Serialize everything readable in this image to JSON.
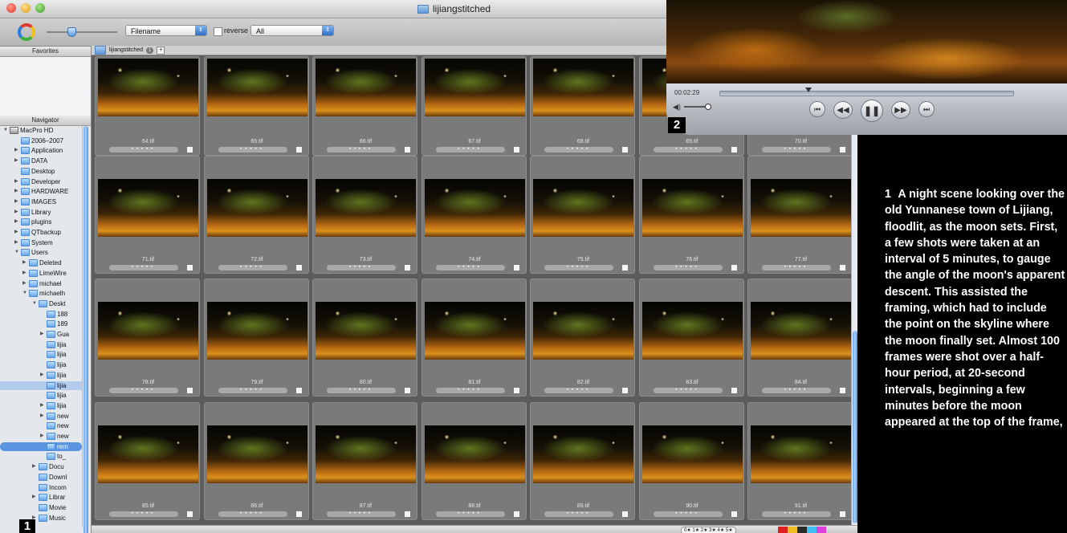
{
  "window": {
    "title": "lijiangstitched"
  },
  "toolbar": {
    "sort_value": "Filename",
    "reverse_label": "reverse",
    "filter_value": "All"
  },
  "sidebar": {
    "favorites_label": "Favorites",
    "navigator_label": "Navigator",
    "tree": [
      {
        "label": "MacPro HD",
        "depth": 0,
        "expanded": true
      },
      {
        "label": "2006–2007",
        "depth": 1
      },
      {
        "label": "Application",
        "depth": 1,
        "collapsed": true
      },
      {
        "label": "DATA",
        "depth": 1,
        "collapsed": true
      },
      {
        "label": "Desktop",
        "depth": 1
      },
      {
        "label": "Developer",
        "depth": 1,
        "collapsed": true
      },
      {
        "label": "HARDWARE",
        "depth": 1,
        "collapsed": true
      },
      {
        "label": "IMAGES",
        "depth": 1,
        "collapsed": true
      },
      {
        "label": "Library",
        "depth": 1,
        "collapsed": true
      },
      {
        "label": "plugins",
        "depth": 1,
        "collapsed": true
      },
      {
        "label": "QTbackup",
        "depth": 1,
        "collapsed": true
      },
      {
        "label": "System",
        "depth": 1,
        "collapsed": true
      },
      {
        "label": "Users",
        "depth": 1,
        "expanded": true
      },
      {
        "label": "Deleted",
        "depth": 2,
        "collapsed": true
      },
      {
        "label": "LimeWire",
        "depth": 2,
        "collapsed": true
      },
      {
        "label": "michael",
        "depth": 2,
        "collapsed": true
      },
      {
        "label": "michaelh",
        "depth": 2,
        "expanded": true
      },
      {
        "label": "Deskt",
        "depth": 3,
        "expanded": true
      },
      {
        "label": "188",
        "depth": 4
      },
      {
        "label": "189",
        "depth": 4
      },
      {
        "label": "Gua",
        "depth": 4,
        "collapsed": true
      },
      {
        "label": "lijia",
        "depth": 4
      },
      {
        "label": "lijia",
        "depth": 4
      },
      {
        "label": "lijia",
        "depth": 4
      },
      {
        "label": "lijia",
        "depth": 4,
        "collapsed": true
      },
      {
        "label": "lijia",
        "depth": 4,
        "selected": true
      },
      {
        "label": "lijia",
        "depth": 4
      },
      {
        "label": "lijia",
        "depth": 4,
        "collapsed": true
      },
      {
        "label": "new",
        "depth": 4,
        "collapsed": true
      },
      {
        "label": "new",
        "depth": 4
      },
      {
        "label": "new",
        "depth": 4,
        "collapsed": true
      },
      {
        "label": "rem",
        "depth": 4,
        "highlighted": true
      },
      {
        "label": "to_",
        "depth": 4
      },
      {
        "label": "Docu",
        "depth": 3,
        "collapsed": true
      },
      {
        "label": "Downl",
        "depth": 3
      },
      {
        "label": "Incom",
        "depth": 3
      },
      {
        "label": "Librar",
        "depth": 3,
        "collapsed": true
      },
      {
        "label": "Movie",
        "depth": 3
      },
      {
        "label": "Music",
        "depth": 3,
        "collapsed": true
      }
    ]
  },
  "tab": {
    "label": "lijiangstitched",
    "count": "1"
  },
  "thumbnails": [
    "64.tif",
    "65.tif",
    "66.tif",
    "67.tif",
    "68.tif",
    "69.tif",
    "70.tif",
    "71.tif",
    "72.tif",
    "73.tif",
    "74.tif",
    "75.tif",
    "76.tif",
    "77.tif",
    "78.tif",
    "79.tif",
    "80.tif",
    "81.tif",
    "82.tif",
    "83.tif",
    "84.tif",
    "85.tif",
    "86.tif",
    "87.tif",
    "88.tif",
    "89.tif",
    "90.tif",
    "91.tif"
  ],
  "statusbar": {
    "star_filter": "0★ 1★ 2★ 3★ 4★ 5★"
  },
  "player": {
    "timecode": "00:02:29",
    "progress": 0.3
  },
  "callouts": {
    "one": "1",
    "two": "2"
  },
  "caption": {
    "number": "1",
    "text": "A night scene looking over the old Yunnanese town of Lijiang, floodlit, as the moon sets. First, a few shots were taken at an interval of 5 minutes, to gauge the angle of the moon's apparent descent. This assisted the framing, which had to include the point on the skyline where the moon finally set. Almost 100 frames were shot over a half-hour period, at 20-second intervals, beginning a few minutes before the moon appeared at the top of the frame,"
  },
  "colors": {
    "selection": "#b5cbeb",
    "accent": "#4d8ad0"
  }
}
